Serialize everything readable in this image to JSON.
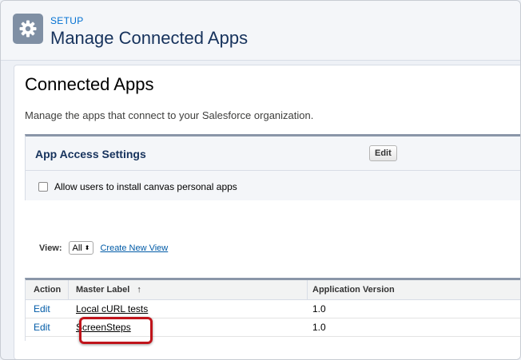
{
  "header": {
    "section_label": "SETUP",
    "title": "Manage Connected Apps",
    "icon": "gear-icon"
  },
  "main": {
    "title": "Connected Apps",
    "description": "Manage the apps that connect to your Salesforce organization."
  },
  "access_settings": {
    "title": "App Access Settings",
    "edit_label": "Edit",
    "checkbox_label": "Allow users to install canvas personal apps",
    "checkbox_checked": false
  },
  "view": {
    "label": "View:",
    "selected": "All",
    "create_link": "Create New View"
  },
  "table": {
    "columns": [
      "Action",
      "Master Label",
      "Application Version"
    ],
    "sort_indicator": "↑",
    "rows": [
      {
        "action": "Edit",
        "label": "Local cURL tests",
        "version": "1.0"
      },
      {
        "action": "Edit",
        "label": "ScreenSteps",
        "version": "1.0"
      }
    ],
    "highlight_color": "#c0141b"
  }
}
